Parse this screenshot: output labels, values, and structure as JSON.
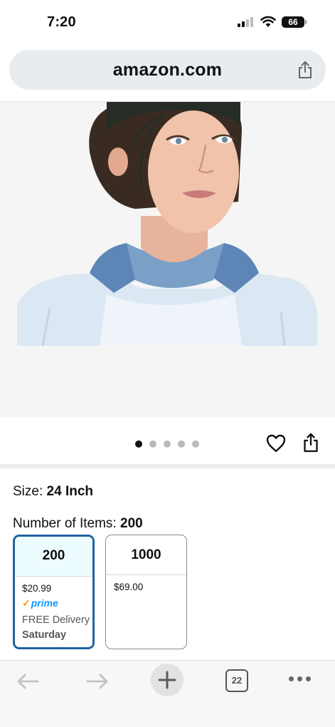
{
  "status_bar": {
    "time": "7:20",
    "battery": "66"
  },
  "browser": {
    "url": "amazon.com",
    "open_tabs": "22"
  },
  "gallery": {
    "image_count": 5,
    "active_index": 0
  },
  "product": {
    "size_label": "Size:",
    "size_value": "24 Inch",
    "items_label": "Number of Items:",
    "items_value": "200"
  },
  "options": [
    {
      "title": "200",
      "price": "$20.99",
      "prime": "prime",
      "delivery": "FREE Delivery",
      "delivery_day": "Saturday",
      "selected": true
    },
    {
      "title": "1000",
      "price": "$69.00",
      "selected": false
    }
  ],
  "colors": {
    "accent": "#2162a1",
    "prime_blue": "#1399ff",
    "prime_check": "#ff9900"
  }
}
